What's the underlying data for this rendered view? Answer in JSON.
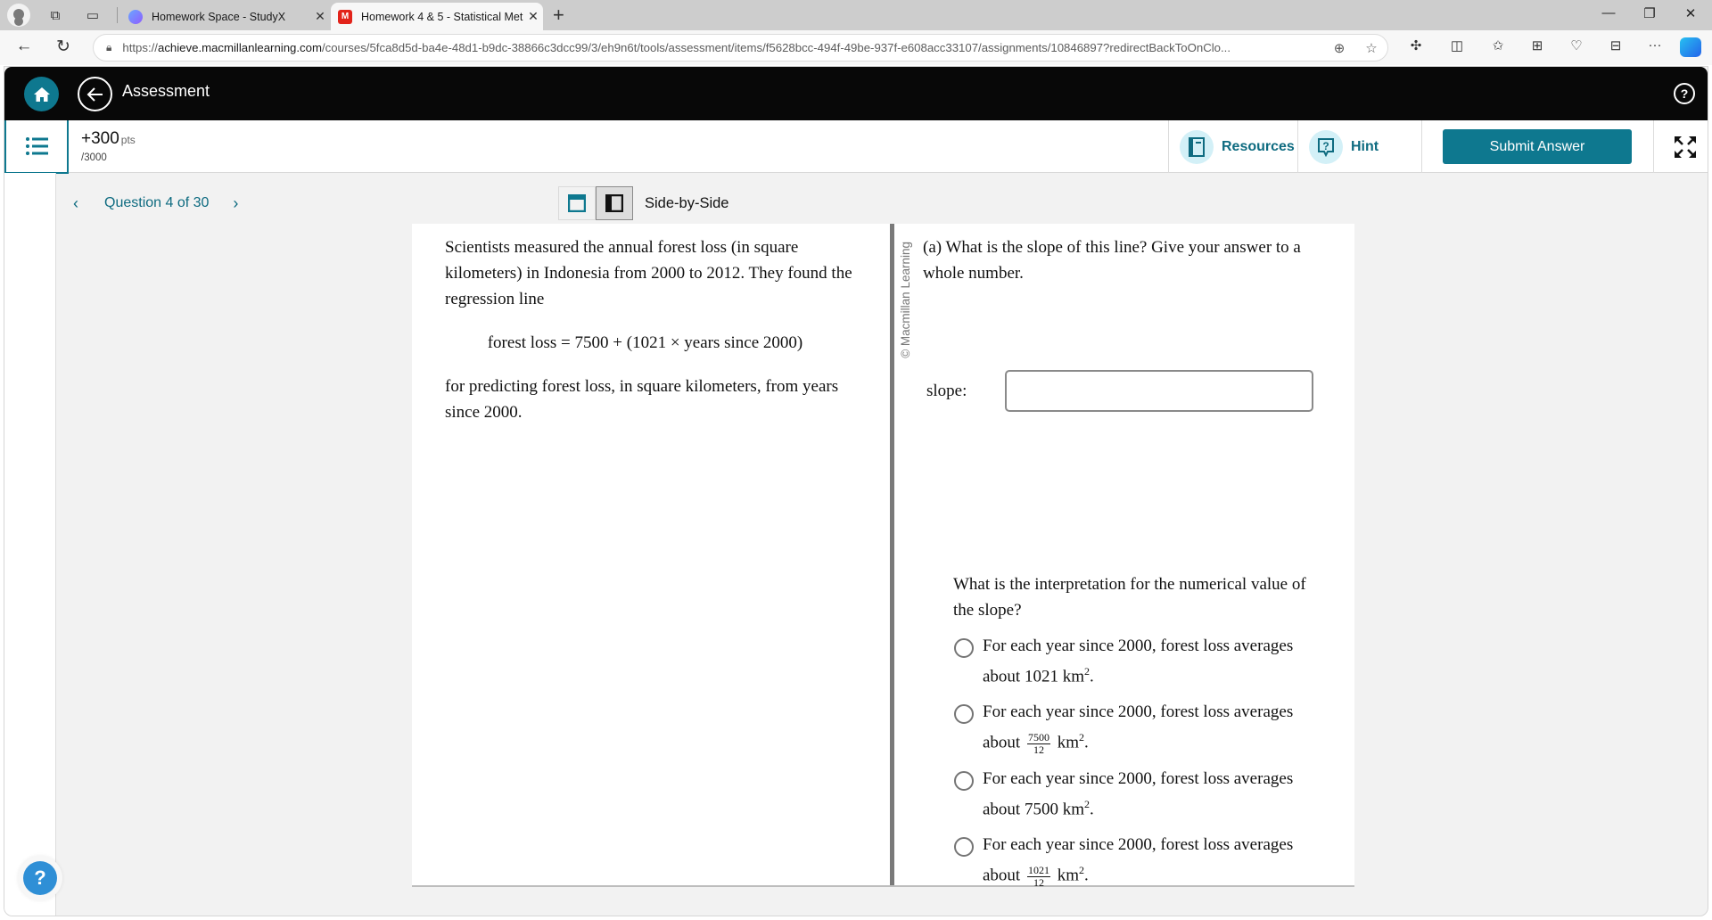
{
  "browser": {
    "tabs": [
      {
        "title": "Homework Space - StudyX",
        "active": false,
        "favicon": "studyx-icon"
      },
      {
        "title": "Homework 4 & 5 - Statistical Met",
        "active": true,
        "favicon": "macmillan-icon"
      }
    ],
    "url_scheme": "https://",
    "url_host": "achieve.macmillanlearning.com",
    "url_path": "/courses/5fca8d5d-ba4e-48d1-b9dc-38866c3dcc99/3/eh9n6t/tools/assessment/items/f5628bcc-494f-49be-937f-e608acc33107/assignments/10846897?redirectBackToOnClo..."
  },
  "header": {
    "title": "Assessment",
    "help_glyph": "?"
  },
  "toolbar": {
    "points_value": "+300",
    "points_unit": "pts",
    "points_total": "/3000",
    "resources_label": "Resources",
    "hint_label": "Hint",
    "submit_label": "Submit Answer"
  },
  "nav": {
    "question_label": "Question 4 of 30",
    "view_mode_label": "Side-by-Side",
    "view_mode_active": "side-by-side"
  },
  "passage": {
    "intro": "Scientists measured the annual forest loss (in square kilometers) in Indonesia from 2000 to 2012. They found the regression line",
    "equation": "forest loss = 7500 + (1021 × years since 2000)",
    "outro": "for predicting forest loss, in square kilometers, from years since 2000."
  },
  "question": {
    "copyright": "© Macmillan Learning",
    "part_a": "(a) What is the slope of this line? Give your answer to a whole number.",
    "slope_label": "slope:",
    "slope_value": "",
    "interpretation_prompt": "What is the interpretation for the numerical value of the slope?",
    "options": [
      {
        "text": "For each year since 2000, forest loss averages about",
        "value": "1021",
        "fraction": null,
        "unit": "km",
        "exp": "2",
        "selected": false
      },
      {
        "text": "For each year since 2000, forest loss averages about",
        "value": null,
        "fraction": {
          "num": "7500",
          "den": "12"
        },
        "unit": "km",
        "exp": "2",
        "selected": false
      },
      {
        "text": "For each year since 2000, forest loss averages about",
        "value": "7500",
        "fraction": null,
        "unit": "km",
        "exp": "2",
        "selected": false
      },
      {
        "text": "For each year since 2000, forest loss averages about",
        "value": null,
        "fraction": {
          "num": "1021",
          "den": "12"
        },
        "unit": "km",
        "exp": "2",
        "selected": false
      }
    ]
  },
  "help_fab": "?",
  "colors": {
    "brand_teal": "#0e788f",
    "link_teal": "#0e6b80",
    "header_black": "#080808",
    "help_blue": "#2f8fd6"
  }
}
